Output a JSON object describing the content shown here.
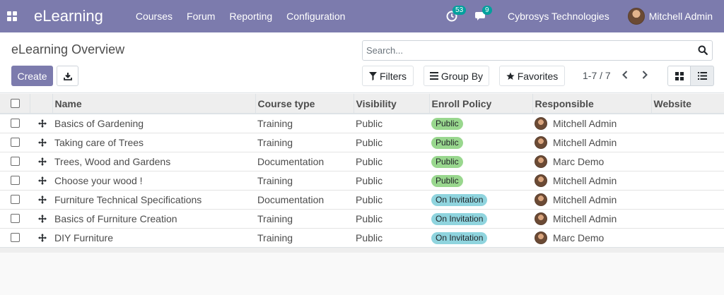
{
  "navbar": {
    "brand": "eLearning",
    "menu": [
      "Courses",
      "Forum",
      "Reporting",
      "Configuration"
    ],
    "activity_badge": "53",
    "messages_badge": "9",
    "company": "Cybrosys Technologies",
    "user": "Mitchell Admin"
  },
  "control": {
    "title": "eLearning Overview",
    "search_placeholder": "Search...",
    "create_label": "Create",
    "filters_label": "Filters",
    "groupby_label": "Group By",
    "favorites_label": "Favorites",
    "pager": "1-7 / 7"
  },
  "table": {
    "columns": [
      "Name",
      "Course type",
      "Visibility",
      "Enroll Policy",
      "Responsible",
      "Website"
    ],
    "rows": [
      {
        "name": "Basics of Gardening",
        "type": "Training",
        "visibility": "Public",
        "policy": "Public",
        "responsible": "Mitchell Admin"
      },
      {
        "name": "Taking care of Trees",
        "type": "Training",
        "visibility": "Public",
        "policy": "Public",
        "responsible": "Mitchell Admin"
      },
      {
        "name": "Trees, Wood and Gardens",
        "type": "Documentation",
        "visibility": "Public",
        "policy": "Public",
        "responsible": "Marc Demo"
      },
      {
        "name": "Choose your wood !",
        "type": "Training",
        "visibility": "Public",
        "policy": "Public",
        "responsible": "Mitchell Admin"
      },
      {
        "name": "Furniture Technical Specifications",
        "type": "Documentation",
        "visibility": "Public",
        "policy": "On Invitation",
        "responsible": "Mitchell Admin"
      },
      {
        "name": "Basics of Furniture Creation",
        "type": "Training",
        "visibility": "Public",
        "policy": "On Invitation",
        "responsible": "Mitchell Admin"
      },
      {
        "name": "DIY Furniture",
        "type": "Training",
        "visibility": "Public",
        "policy": "On Invitation",
        "responsible": "Marc Demo"
      }
    ]
  },
  "colors": {
    "navbar": "#7c7bad",
    "badge": "#00a09d",
    "pill_public": "#99d78e",
    "pill_invitation": "#8fd4de"
  }
}
